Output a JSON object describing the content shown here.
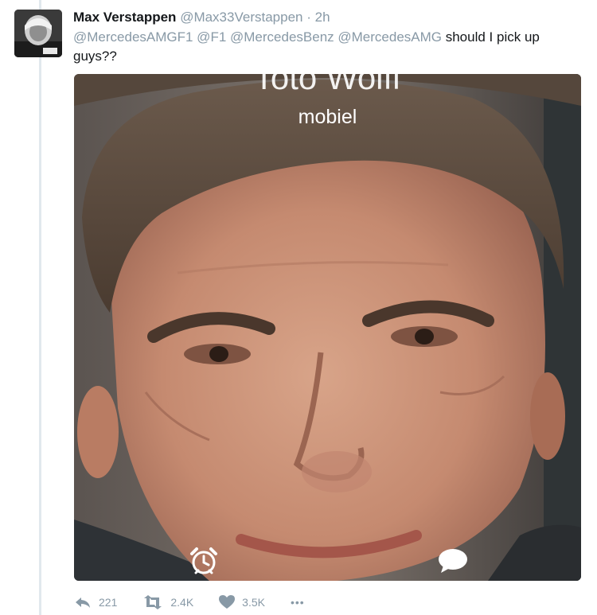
{
  "tweet": {
    "author": {
      "display_name": "Max Verstappen",
      "handle": "@Max33Verstappen",
      "separator": "·",
      "time": "2h"
    },
    "text": {
      "mentions": "@MercedesAMGF1 @F1 @MercedesBenz @MercedesAMG",
      "message": " should I pick up guys??"
    },
    "media": {
      "caller_name_partial": "Toto Wolff",
      "caller_label": "mobiel",
      "icons": [
        "alarm-clock-icon",
        "message-bubble-icon"
      ]
    },
    "actions": {
      "reply_count": "221",
      "retweet_count": "2.4K",
      "like_count": "3.5K",
      "more_label": "•••"
    }
  },
  "colors": {
    "muted": "#8899a6",
    "text": "#14171a",
    "thread_line": "#e1e8ed"
  }
}
